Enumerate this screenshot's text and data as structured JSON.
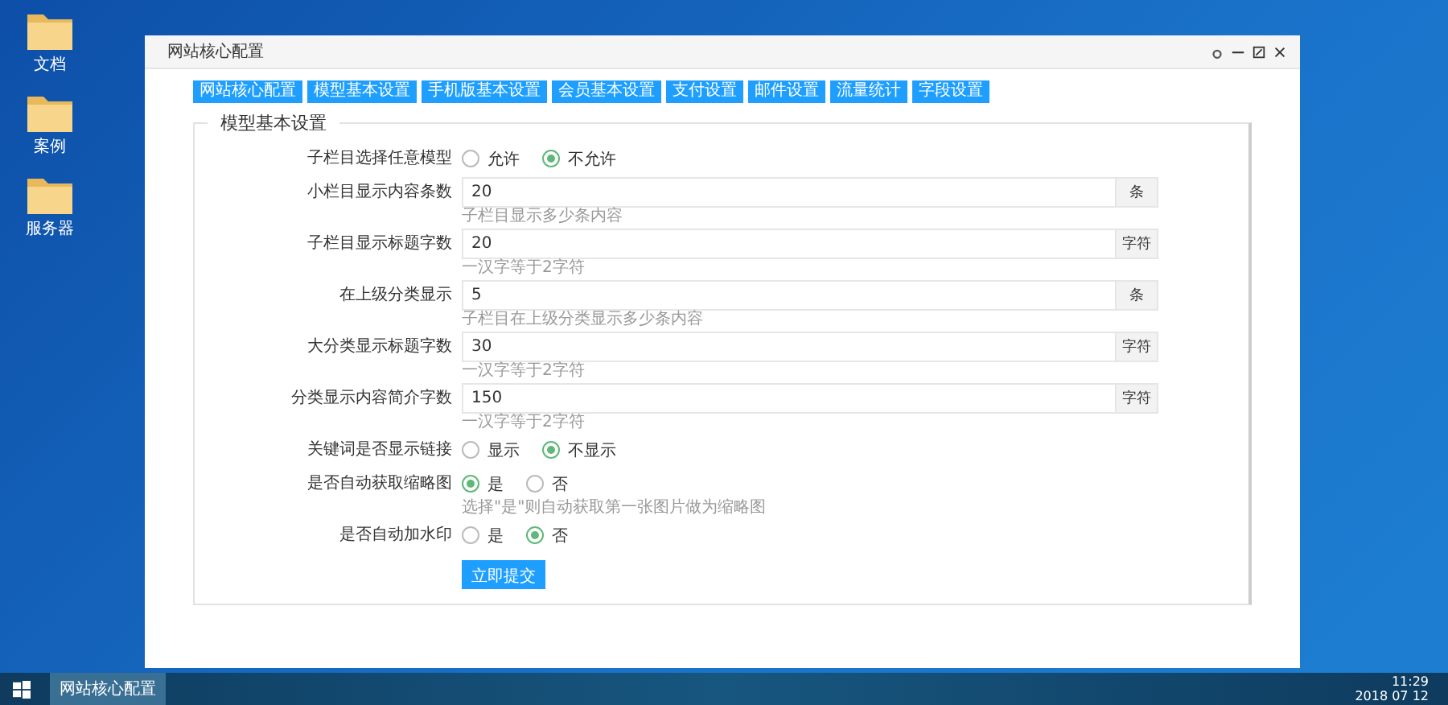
{
  "desktop_icons": [
    {
      "label": "文档"
    },
    {
      "label": "案例"
    },
    {
      "label": "服务器"
    }
  ],
  "window": {
    "title": "网站核心配置"
  },
  "tabs": [
    {
      "label": "网站核心配置"
    },
    {
      "label": "模型基本设置"
    },
    {
      "label": "手机版基本设置"
    },
    {
      "label": "会员基本设置"
    },
    {
      "label": "支付设置"
    },
    {
      "label": "邮件设置"
    },
    {
      "label": "流量统计"
    },
    {
      "label": "字段设置"
    }
  ],
  "section": {
    "legend": "模型基本设置"
  },
  "fields": [
    {
      "kind": "radio",
      "label": "子栏目选择任意模型",
      "options": [
        {
          "label": "允许",
          "selected": false
        },
        {
          "label": "不允许",
          "selected": true
        }
      ]
    },
    {
      "kind": "input",
      "label": "小栏目显示内容条数",
      "value": "20",
      "unit": "条",
      "hint": "子栏目显示多少条内容"
    },
    {
      "kind": "input",
      "label": "子栏目显示标题字数",
      "value": "20",
      "unit": "字符",
      "hint": "一汉字等于2字符"
    },
    {
      "kind": "input",
      "label": "在上级分类显示",
      "value": "5",
      "unit": "条",
      "hint": "子栏目在上级分类显示多少条内容"
    },
    {
      "kind": "input",
      "label": "大分类显示标题字数",
      "value": "30",
      "unit": "字符",
      "hint": "一汉字等于2字符"
    },
    {
      "kind": "input",
      "label": "分类显示内容简介字数",
      "value": "150",
      "unit": "字符",
      "hint": "一汉字等于2字符"
    },
    {
      "kind": "radio",
      "label": "关键词是否显示链接",
      "options": [
        {
          "label": "显示",
          "selected": false
        },
        {
          "label": "不显示",
          "selected": true
        }
      ]
    },
    {
      "kind": "radio",
      "label": "是否自动获取缩略图",
      "options": [
        {
          "label": "是",
          "selected": true
        },
        {
          "label": "否",
          "selected": false
        }
      ],
      "hint": "选择\"是\"则自动获取第一张图片做为缩略图"
    },
    {
      "kind": "radio",
      "label": "是否自动加水印",
      "options": [
        {
          "label": "是",
          "selected": false
        },
        {
          "label": "否",
          "selected": true
        }
      ]
    }
  ],
  "submit": "立即提交",
  "taskbar": {
    "app": "网站核心配置",
    "time": "11:29",
    "date": "2018 07 12"
  }
}
